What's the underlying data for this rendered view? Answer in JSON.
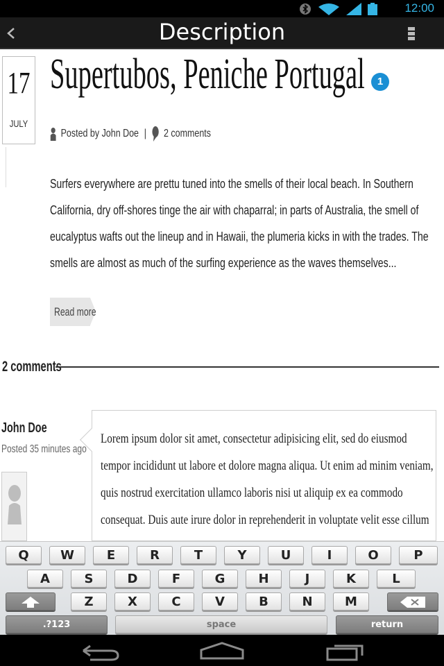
{
  "status_bar": {
    "time": "12:00",
    "icons": [
      "bluetooth-icon",
      "wifi-icon",
      "signal-icon",
      "battery-icon"
    ]
  },
  "action_bar": {
    "title": "Description",
    "back_icon": "chevron-left-icon",
    "menu_icon": "overflow-menu-icon"
  },
  "post": {
    "day": "17",
    "month": "JULY",
    "title": "Supertubos, Peniche Portugal",
    "badge": "1",
    "author": "Posted by John Doe",
    "separator": "|",
    "comment_count": "2 comments",
    "excerpt": "Surfers everywhere are prettu tuned into the smells of their local beach. In Southern California, dry off-shores tinge the air with chaparral; in parts of Australia, the smell of eucalyptus  wafts out the lineup and in Hawaii, the plumeria kicks in with the trades.  The smells are almost as much of the surfing experience as the waves themselves...",
    "read_more": "Read more"
  },
  "comments": {
    "heading": "2 comments",
    "items": [
      {
        "author": "John Doe",
        "time": "Posted 35 minutes ago",
        "text": "Lorem ipsum dolor sit amet, consectetur adipisicing elit, sed do eiusmod tempor incididunt ut labore et dolore magna aliqua. Ut enim ad minim veniam, quis nostrud exercitation ullamco laboris nisi ut aliquip ex ea commodo consequat. Duis aute irure dolor in reprehenderit in voluptate velit esse cillum dolore eu fugiat nulla pariatur."
      }
    ]
  },
  "keyboard": {
    "row1": [
      "Q",
      "W",
      "E",
      "R",
      "T",
      "Y",
      "U",
      "I",
      "O",
      "P"
    ],
    "row2": [
      "A",
      "S",
      "D",
      "F",
      "G",
      "H",
      "J",
      "K",
      "L"
    ],
    "row3": [
      "Z",
      "X",
      "C",
      "V",
      "B",
      "N",
      "M"
    ],
    "symbols": ".?123",
    "space": "space",
    "return": "return",
    "shift_icon": "shift-icon",
    "backspace_icon": "backspace-icon"
  },
  "nav_bar": {
    "icons": [
      "back-icon",
      "home-icon",
      "recent-apps-icon"
    ]
  },
  "colors": {
    "accent": "#35b5e5",
    "badge": "#1a8fd4",
    "action_bar": "#1a1a1a"
  }
}
